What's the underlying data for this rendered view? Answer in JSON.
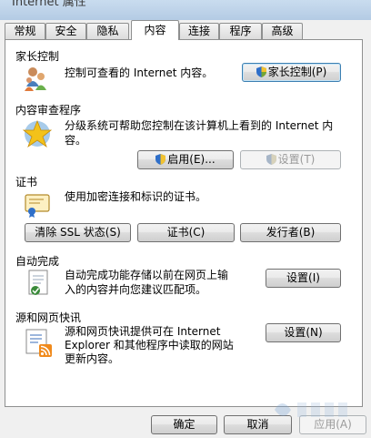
{
  "window": {
    "title": "Internet 属性"
  },
  "tabs": [
    {
      "label": "常规"
    },
    {
      "label": "安全"
    },
    {
      "label": "隐私"
    },
    {
      "label": "内容"
    },
    {
      "label": "连接"
    },
    {
      "label": "程序"
    },
    {
      "label": "高级"
    }
  ],
  "active_tab": "内容",
  "parental": {
    "heading": "家长控制",
    "description": "控制可查看的 Internet 内容。",
    "button": "家长控制(P)"
  },
  "advisor": {
    "heading": "内容审查程序",
    "description_line1": "分级系统可帮助您控制在该计算机上看到的 Internet 内",
    "description_line2": "容。",
    "enable_button": "启用(E)...",
    "settings_button": "设置(T)"
  },
  "certificates": {
    "heading": "证书",
    "description": "使用加密连接和标识的证书。",
    "clear_ssl_button": "清除 SSL 状态(S)",
    "certificates_button": "证书(C)",
    "publishers_button": "发行者(B)"
  },
  "autocomplete": {
    "heading": "自动完成",
    "description_line1": "自动完成功能存储以前在网页上输",
    "description_line2": "入的内容并向您建议匹配项。",
    "settings_button": "设置(I)"
  },
  "feeds": {
    "heading": "源和网页快讯",
    "description_line1": "源和网页快讯提供可在 Internet",
    "description_line2": "Explorer 和其他程序中读取的网站",
    "description_line3": "更新内容。",
    "settings_button": "设置(N)"
  },
  "footer": {
    "ok": "确定",
    "cancel": "取消",
    "apply": "应用(A)"
  }
}
